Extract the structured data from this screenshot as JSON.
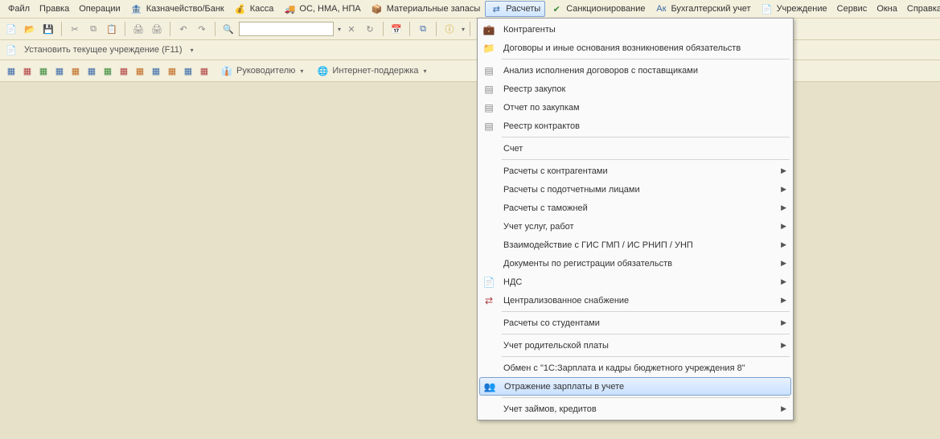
{
  "menubar": {
    "file": "Файл",
    "edit": "Правка",
    "operations": "Операции",
    "treasury": "Казначейство/Банк",
    "cash": "Касса",
    "assets": "ОС, НМА, НПА",
    "inventory": "Материальные запасы",
    "calculations": "Расчеты",
    "sanctions": "Санкционирование",
    "accounting": "Бухгалтерский учет",
    "institution": "Учреждение",
    "service": "Сервис",
    "windows": "Окна",
    "help": "Справка"
  },
  "secondbar": {
    "set_institution": "Установить текущее учреждение (F11)"
  },
  "thirdbar": {
    "to_manager": "Руководителю",
    "internet_support": "Интернет-поддержка"
  },
  "dropdown": {
    "counterparties": "Контрагенты",
    "contracts": "Договоры и иные основания возникновения обязательств",
    "analysis": "Анализ исполнения договоров с поставщиками",
    "purchase_registry": "Реестр закупок",
    "purchase_report": "Отчет по закупкам",
    "contract_registry": "Реестр контрактов",
    "account": "Счет",
    "with_counterparties": "Расчеты с контрагентами",
    "with_accountable": "Расчеты с подотчетными лицами",
    "with_customs": "Расчеты с таможней",
    "services_work": "Учет услуг, работ",
    "gis_gmp": "Взаимодействие с ГИС ГМП / ИС РНИП / УНП",
    "obligation_docs": "Документы по регистрации обязательств",
    "vat": "НДС",
    "central_supply": "Централизованное снабжение",
    "with_students": "Расчеты со студентами",
    "parental_fee": "Учет родительской платы",
    "exchange_1c": "Обмен с \"1С:Зарплата и кадры бюджетного учреждения 8\"",
    "salary_reflection": "Отражение зарплаты в учете",
    "loans_credits": "Учет займов, кредитов"
  }
}
